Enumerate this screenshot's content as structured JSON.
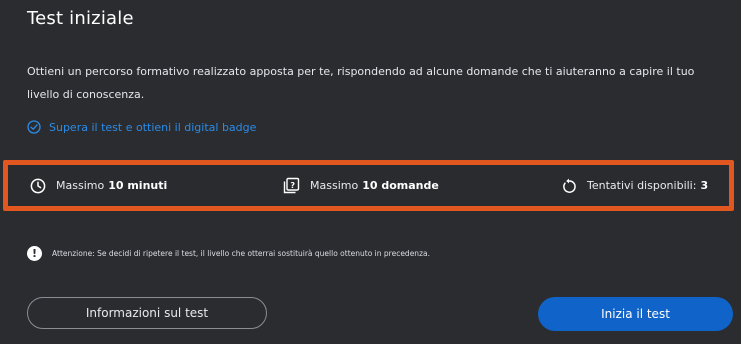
{
  "header": {
    "title": "Test iniziale"
  },
  "intro": {
    "description": "Ottieni un percorso formativo realizzato apposta per te, rispondendo ad alcune domande che ti aiuteranno a capire il tuo livello di conoscenza."
  },
  "badge": {
    "text": "Supera il test e ottieni il digital badge",
    "icon": "check-circle-icon",
    "color": "#2b8be6"
  },
  "info": {
    "highlight_color": "#e2571f",
    "items": [
      {
        "icon": "clock-icon",
        "label": "Massimo",
        "value": "10 minuti"
      },
      {
        "icon": "question-list-icon",
        "label": "Massimo",
        "value": "10 domande"
      },
      {
        "icon": "retry-icon",
        "label": "Tentativi disponibili:",
        "value": "3"
      }
    ]
  },
  "warning": {
    "icon": "exclamation-circle-icon",
    "text": "Attenzione: Se decidi di ripetere il test, il livello che otterrai sostituirà quello ottenuto in precedenza."
  },
  "actions": {
    "info_button": "Informazioni sul test",
    "start_button": "Inizia il test",
    "primary_color": "#0f63c9"
  }
}
